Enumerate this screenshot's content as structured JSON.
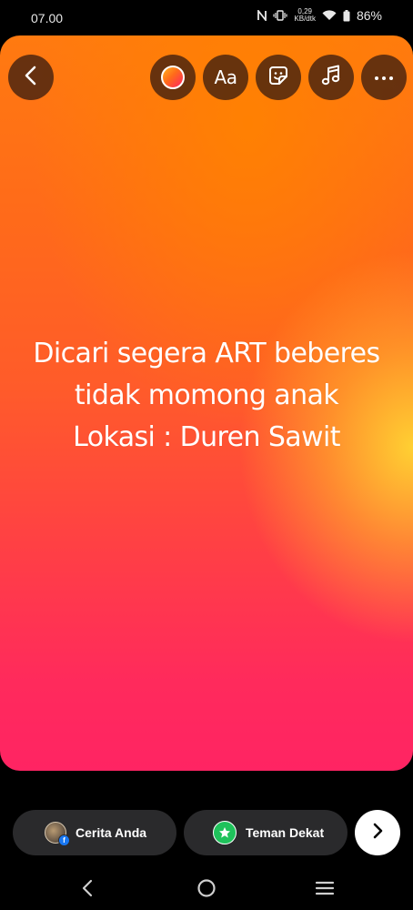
{
  "status_bar": {
    "time": "07.00",
    "net_speed_value": "0,29",
    "net_speed_unit": "KB/dtk",
    "battery": "86%",
    "icons": [
      "nfc-icon",
      "vibrate-icon",
      "wifi-icon",
      "battery-icon"
    ]
  },
  "story": {
    "text_lines": [
      "Dicari segera ART beberes",
      "tidak momong anak",
      "Lokasi : Duren Sawit"
    ],
    "background_colors": [
      "#ff7a10",
      "#ff2463",
      "#ffd732"
    ]
  },
  "toolbar": {
    "back_icon": "chevron-left-icon",
    "color_icon": "color-swatch-icon",
    "text_label": "Aa",
    "sticker_icon": "sticker-icon",
    "music_icon": "music-note-icon",
    "more_icon": "more-horizontal-icon"
  },
  "share": {
    "your_story_label": "Cerita Anda",
    "close_friends_label": "Teman Dekat",
    "next_icon": "chevron-right-icon",
    "close_friends_color": "#1fc25b"
  },
  "nav": {
    "icons": [
      "back-nav-icon",
      "home-nav-icon",
      "recents-nav-icon"
    ]
  }
}
